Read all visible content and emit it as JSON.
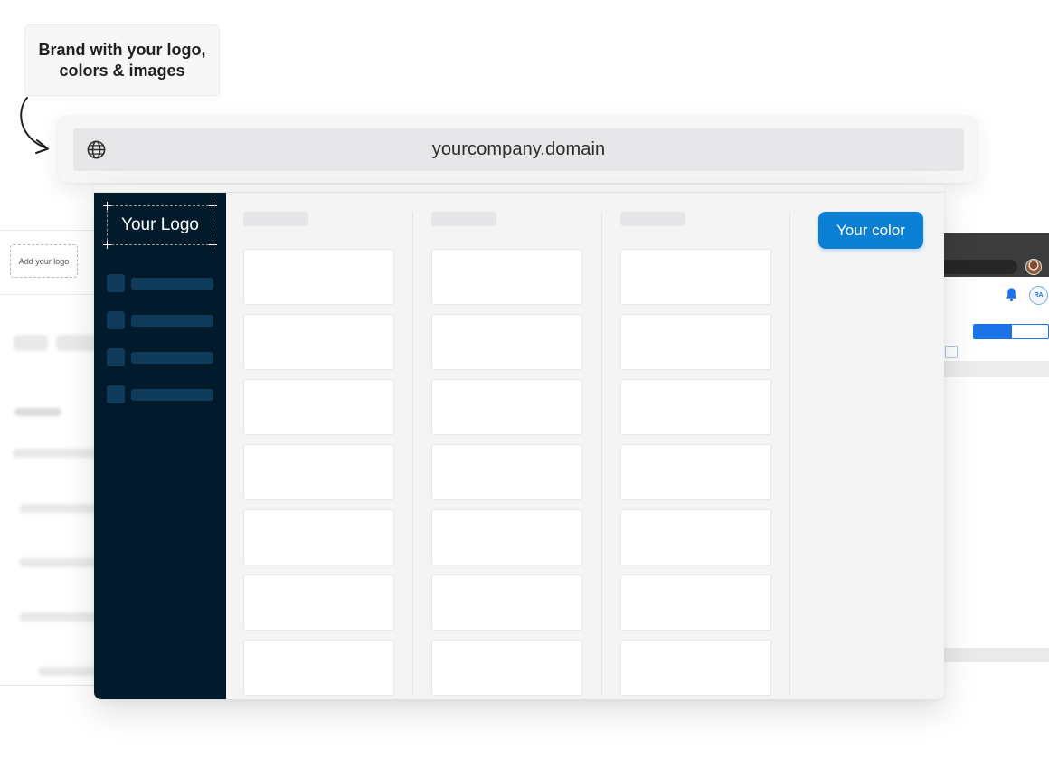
{
  "callout": {
    "text": "Brand with your logo, colors & images"
  },
  "urlbar": {
    "url": "yourcompany.domain",
    "icon": "globe-icon"
  },
  "app": {
    "logo_text": "Your Logo",
    "primary_button": "Your color",
    "accent_color": "#0b7fd4",
    "sidebar_color": "#011b2c",
    "columns": [
      {
        "cards": 7
      },
      {
        "cards": 7
      },
      {
        "cards": 7
      }
    ]
  },
  "bg_left": {
    "logo_slot": "Add your logo"
  },
  "bg_right": {
    "avatar_initials": "RA",
    "icon": "bell-icon"
  }
}
